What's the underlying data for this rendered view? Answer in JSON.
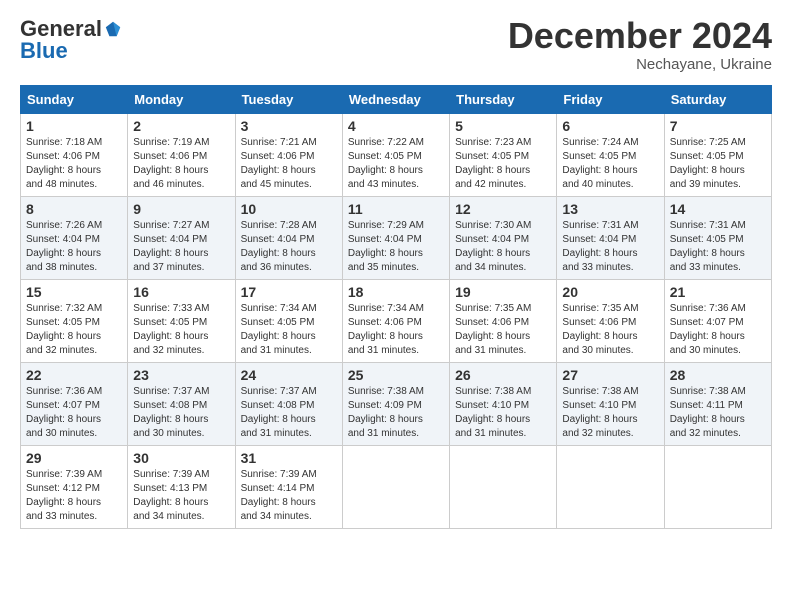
{
  "header": {
    "logo_line1": "General",
    "logo_line2": "Blue",
    "month": "December 2024",
    "location": "Nechayane, Ukraine"
  },
  "days_of_week": [
    "Sunday",
    "Monday",
    "Tuesday",
    "Wednesday",
    "Thursday",
    "Friday",
    "Saturday"
  ],
  "weeks": [
    [
      {
        "day": "1",
        "info": "Sunrise: 7:18 AM\nSunset: 4:06 PM\nDaylight: 8 hours\nand 48 minutes."
      },
      {
        "day": "2",
        "info": "Sunrise: 7:19 AM\nSunset: 4:06 PM\nDaylight: 8 hours\nand 46 minutes."
      },
      {
        "day": "3",
        "info": "Sunrise: 7:21 AM\nSunset: 4:06 PM\nDaylight: 8 hours\nand 45 minutes."
      },
      {
        "day": "4",
        "info": "Sunrise: 7:22 AM\nSunset: 4:05 PM\nDaylight: 8 hours\nand 43 minutes."
      },
      {
        "day": "5",
        "info": "Sunrise: 7:23 AM\nSunset: 4:05 PM\nDaylight: 8 hours\nand 42 minutes."
      },
      {
        "day": "6",
        "info": "Sunrise: 7:24 AM\nSunset: 4:05 PM\nDaylight: 8 hours\nand 40 minutes."
      },
      {
        "day": "7",
        "info": "Sunrise: 7:25 AM\nSunset: 4:05 PM\nDaylight: 8 hours\nand 39 minutes."
      }
    ],
    [
      {
        "day": "8",
        "info": "Sunrise: 7:26 AM\nSunset: 4:04 PM\nDaylight: 8 hours\nand 38 minutes."
      },
      {
        "day": "9",
        "info": "Sunrise: 7:27 AM\nSunset: 4:04 PM\nDaylight: 8 hours\nand 37 minutes."
      },
      {
        "day": "10",
        "info": "Sunrise: 7:28 AM\nSunset: 4:04 PM\nDaylight: 8 hours\nand 36 minutes."
      },
      {
        "day": "11",
        "info": "Sunrise: 7:29 AM\nSunset: 4:04 PM\nDaylight: 8 hours\nand 35 minutes."
      },
      {
        "day": "12",
        "info": "Sunrise: 7:30 AM\nSunset: 4:04 PM\nDaylight: 8 hours\nand 34 minutes."
      },
      {
        "day": "13",
        "info": "Sunrise: 7:31 AM\nSunset: 4:04 PM\nDaylight: 8 hours\nand 33 minutes."
      },
      {
        "day": "14",
        "info": "Sunrise: 7:31 AM\nSunset: 4:05 PM\nDaylight: 8 hours\nand 33 minutes."
      }
    ],
    [
      {
        "day": "15",
        "info": "Sunrise: 7:32 AM\nSunset: 4:05 PM\nDaylight: 8 hours\nand 32 minutes."
      },
      {
        "day": "16",
        "info": "Sunrise: 7:33 AM\nSunset: 4:05 PM\nDaylight: 8 hours\nand 32 minutes."
      },
      {
        "day": "17",
        "info": "Sunrise: 7:34 AM\nSunset: 4:05 PM\nDaylight: 8 hours\nand 31 minutes."
      },
      {
        "day": "18",
        "info": "Sunrise: 7:34 AM\nSunset: 4:06 PM\nDaylight: 8 hours\nand 31 minutes."
      },
      {
        "day": "19",
        "info": "Sunrise: 7:35 AM\nSunset: 4:06 PM\nDaylight: 8 hours\nand 31 minutes."
      },
      {
        "day": "20",
        "info": "Sunrise: 7:35 AM\nSunset: 4:06 PM\nDaylight: 8 hours\nand 30 minutes."
      },
      {
        "day": "21",
        "info": "Sunrise: 7:36 AM\nSunset: 4:07 PM\nDaylight: 8 hours\nand 30 minutes."
      }
    ],
    [
      {
        "day": "22",
        "info": "Sunrise: 7:36 AM\nSunset: 4:07 PM\nDaylight: 8 hours\nand 30 minutes."
      },
      {
        "day": "23",
        "info": "Sunrise: 7:37 AM\nSunset: 4:08 PM\nDaylight: 8 hours\nand 30 minutes."
      },
      {
        "day": "24",
        "info": "Sunrise: 7:37 AM\nSunset: 4:08 PM\nDaylight: 8 hours\nand 31 minutes."
      },
      {
        "day": "25",
        "info": "Sunrise: 7:38 AM\nSunset: 4:09 PM\nDaylight: 8 hours\nand 31 minutes."
      },
      {
        "day": "26",
        "info": "Sunrise: 7:38 AM\nSunset: 4:10 PM\nDaylight: 8 hours\nand 31 minutes."
      },
      {
        "day": "27",
        "info": "Sunrise: 7:38 AM\nSunset: 4:10 PM\nDaylight: 8 hours\nand 32 minutes."
      },
      {
        "day": "28",
        "info": "Sunrise: 7:38 AM\nSunset: 4:11 PM\nDaylight: 8 hours\nand 32 minutes."
      }
    ],
    [
      {
        "day": "29",
        "info": "Sunrise: 7:39 AM\nSunset: 4:12 PM\nDaylight: 8 hours\nand 33 minutes."
      },
      {
        "day": "30",
        "info": "Sunrise: 7:39 AM\nSunset: 4:13 PM\nDaylight: 8 hours\nand 34 minutes."
      },
      {
        "day": "31",
        "info": "Sunrise: 7:39 AM\nSunset: 4:14 PM\nDaylight: 8 hours\nand 34 minutes."
      },
      {
        "day": "",
        "info": ""
      },
      {
        "day": "",
        "info": ""
      },
      {
        "day": "",
        "info": ""
      },
      {
        "day": "",
        "info": ""
      }
    ]
  ]
}
